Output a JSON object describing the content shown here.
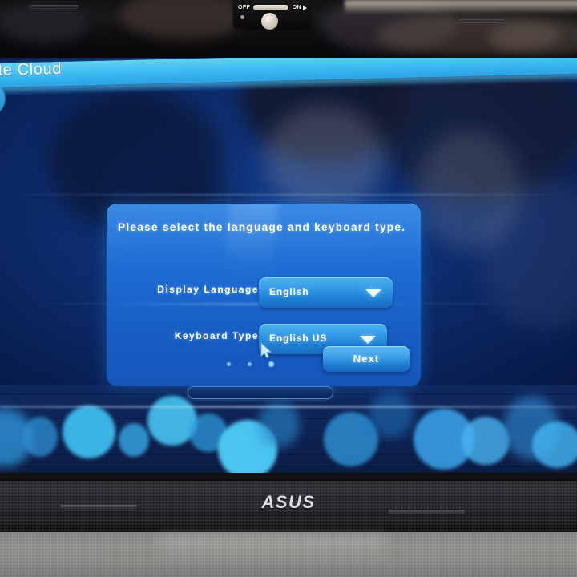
{
  "device": {
    "brand_logo": "ASUS",
    "power_switch": {
      "off_label": "OFF",
      "on_label": "ON",
      "state": "ON"
    }
  },
  "screen": {
    "banner": {
      "text": "ate Cloud",
      "accent_color": "#3fbdf2"
    },
    "background_color": "#0d2c6c",
    "dialog": {
      "heading": "Please select the language and keyboard type.",
      "panel_color": "#1e6ed7",
      "fields": [
        {
          "label": "Display Language",
          "value": "English",
          "caret_icon": "chevron-down-icon"
        },
        {
          "label": "Keyboard Type",
          "value": "English US",
          "caret_icon": "chevron-down-icon"
        }
      ],
      "pagination_dots": 3,
      "next_label": "Next"
    }
  }
}
